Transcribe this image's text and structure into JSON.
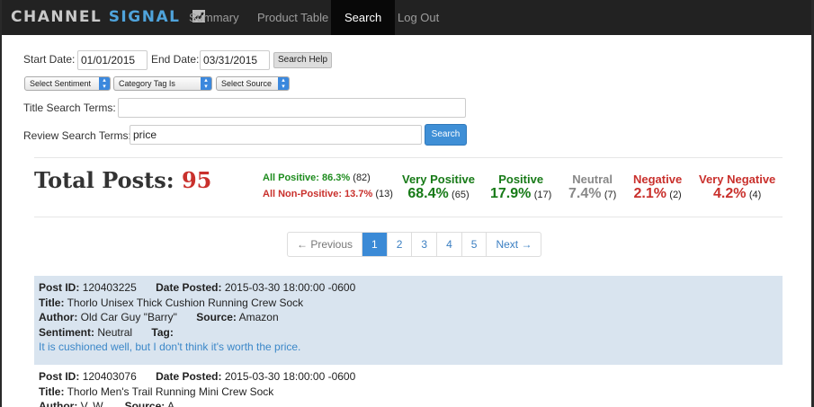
{
  "brand": {
    "name_part1": "CHANNEL",
    "name_part2": "SIGNAL"
  },
  "nav": [
    {
      "label": "Summary",
      "active": false
    },
    {
      "label": "Product Table",
      "active": false
    },
    {
      "label": "Search",
      "active": true
    },
    {
      "label": "Log Out",
      "active": false
    }
  ],
  "form": {
    "start_date_label": "Start Date:",
    "start_date_value": "01/01/2015",
    "end_date_label": "End Date:",
    "end_date_value": "03/31/2015",
    "search_help_label": "Search Help",
    "select_sentiment": "Select Sentiment",
    "category_tag": "Category Tag Is",
    "select_source": "Select Source",
    "title_terms_label": "Title Search Terms:",
    "title_terms_value": "",
    "review_terms_label": "Review Search Terms:",
    "review_terms_value": "price",
    "search_button": "Search"
  },
  "stats": {
    "total_label": "Total Posts:",
    "total_value": "95",
    "all_positive_label": "All Positive: 86.3%",
    "all_positive_count": "(82)",
    "all_nonpositive_label": "All Non-Positive: 13.7%",
    "all_nonpositive_count": "(13)",
    "breakdown": [
      {
        "label": "Very Positive",
        "pct": "68.4%",
        "count": "(65)"
      },
      {
        "label": "Positive",
        "pct": "17.9%",
        "count": "(17)"
      },
      {
        "label": "Neutral",
        "pct": "7.4%",
        "count": "(7)"
      },
      {
        "label": "Negative",
        "pct": "2.1%",
        "count": "(2)"
      },
      {
        "label": "Very Negative",
        "pct": "4.2%",
        "count": "(4)"
      }
    ],
    "colors": {
      "positive": "#177a17",
      "neutral": "#888888",
      "negative": "#c9302c"
    }
  },
  "pagination": {
    "prev": "← Previous",
    "pages": [
      "1",
      "2",
      "3",
      "4",
      "5"
    ],
    "current": "1",
    "next": "Next →"
  },
  "posts": [
    {
      "post_id_label": "Post ID:",
      "post_id": "120403225",
      "date_label": "Date Posted:",
      "date": "2015-03-30 18:00:00 -0600",
      "title_label": "Title:",
      "title": "Thorlo Unisex Thick Cushion Running Crew Sock",
      "author_label": "Author:",
      "author": "Old Car Guy \"Barry\"",
      "source_label": "Source:",
      "source": "Amazon",
      "sentiment_label": "Sentiment:",
      "sentiment": "Neutral",
      "tag_label": "Tag:",
      "tag": "",
      "review": "It is cushioned well, but I don't think it's worth the price."
    },
    {
      "post_id_label": "Post ID:",
      "post_id": "120403076",
      "date_label": "Date Posted:",
      "date": "2015-03-30 18:00:00 -0600",
      "title_label": "Title:",
      "title": "Thorlo Men's Trail Running Mini Crew Sock",
      "author_label": "Author:",
      "author": "V. W.",
      "source_label": "Source:",
      "source": "A"
    }
  ]
}
